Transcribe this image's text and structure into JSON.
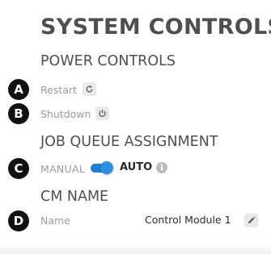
{
  "page": {
    "title": "SYSTEM CONTROLS"
  },
  "power_controls": {
    "heading": "POWER CONTROLS",
    "restart": {
      "marker": "A",
      "label": "Restart",
      "icon": "restart-icon"
    },
    "shutdown": {
      "marker": "B",
      "label": "Shutdown",
      "icon": "power-icon"
    }
  },
  "job_queue": {
    "heading": "JOB QUEUE ASSIGNMENT",
    "marker": "C",
    "off_label": "MANUAL",
    "on_label": "AUTO",
    "toggle_on": true,
    "info_glyph": "i",
    "accent_color": "#2d8fe0"
  },
  "cm_name": {
    "heading": "CM NAME",
    "marker": "D",
    "label": "Name",
    "value": "Control Module 1",
    "edit_icon": "pencil-icon"
  }
}
